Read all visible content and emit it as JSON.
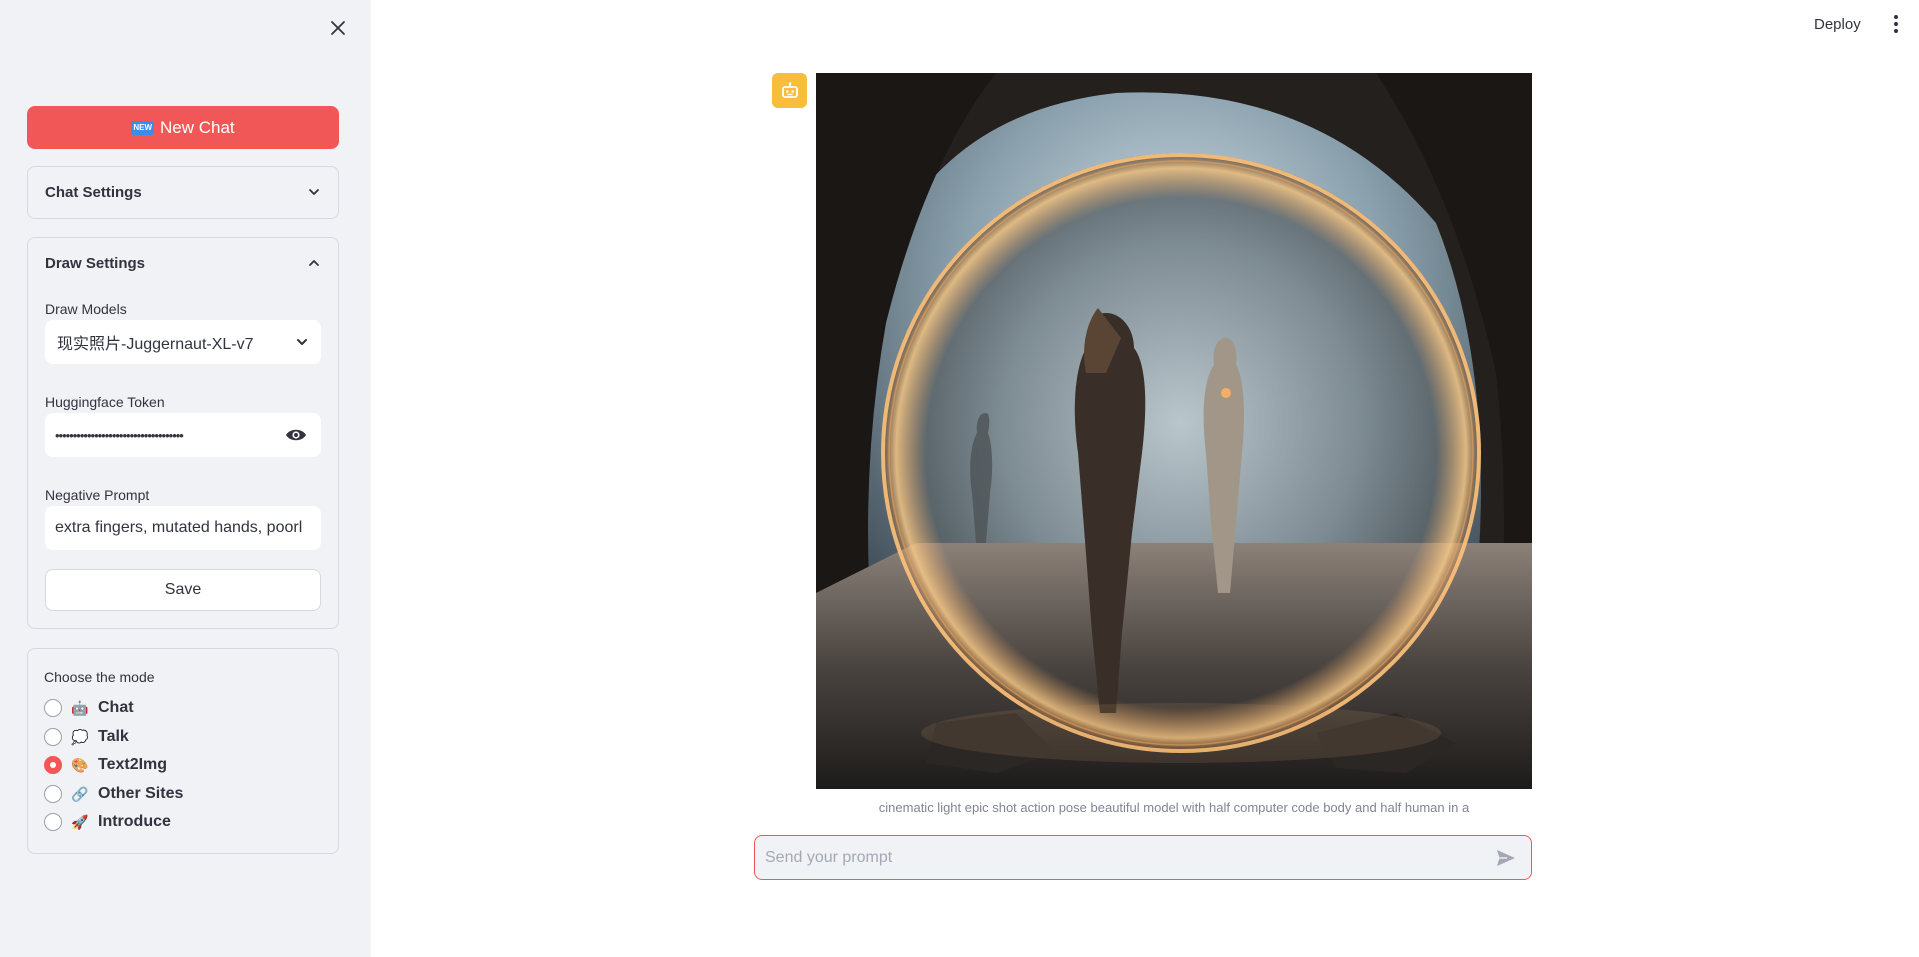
{
  "sidebar": {
    "new_chat_label": "New Chat",
    "new_badge": "NEW",
    "chat_settings_label": "Chat Settings",
    "draw_settings": {
      "title": "Draw Settings",
      "model_label": "Draw Models",
      "model_value": "现实照片-Juggernaut-XL-v7",
      "token_label": "Huggingface Token",
      "token_value": "••••••••••••••••••••••••••••••••••••",
      "negative_label": "Negative Prompt",
      "negative_value": "extra fingers, mutated hands, poorl",
      "save_label": "Save"
    },
    "mode": {
      "title": "Choose the mode",
      "options": [
        {
          "emoji": "🤖",
          "label": "Chat",
          "selected": false
        },
        {
          "emoji": "💭",
          "label": "Talk",
          "selected": false
        },
        {
          "emoji": "🎨",
          "label": "Text2Img",
          "selected": true
        },
        {
          "emoji": "🔗",
          "label": "Other Sites",
          "selected": false
        },
        {
          "emoji": "🚀",
          "label": "Introduce",
          "selected": false
        }
      ]
    }
  },
  "header": {
    "deploy_label": "Deploy"
  },
  "main": {
    "caption": "cinematic light epic shot action pose beautiful model with half computer code body and half human in a",
    "prompt_placeholder": "Send your prompt"
  },
  "colors": {
    "accent": "#f25757",
    "sidebar_bg": "#f0f2f6",
    "avatar_bg": "#f8bd3a"
  }
}
